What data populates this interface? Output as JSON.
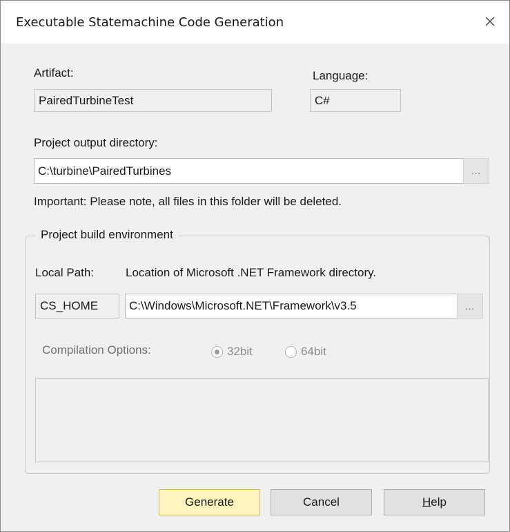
{
  "window": {
    "title": "Executable Statemachine Code Generation",
    "close_icon": "close-icon"
  },
  "artifact": {
    "label": "Artifact:",
    "value": "PairedTurbineTest"
  },
  "language": {
    "label": "Language:",
    "value": "C#"
  },
  "output": {
    "label": "Project output directory:",
    "value": "C:\\turbine\\PairedTurbines",
    "browse_label": "...",
    "note": "Important: Please note, all files in this folder will be deleted."
  },
  "build_env": {
    "group_label": "Project build environment",
    "local_path_label": "Local Path:",
    "local_path_desc": "Location of Microsoft .NET Framework directory.",
    "local_path_key": "CS_HOME",
    "local_path_value": "C:\\Windows\\Microsoft.NET\\Framework\\v3.5",
    "browse_label": "...",
    "compilation_label": "Compilation Options:",
    "option_32": "32bit",
    "option_64": "64bit",
    "selected_option": "32bit"
  },
  "buttons": {
    "generate": "Generate",
    "cancel": "Cancel",
    "help_first": "H",
    "help_rest": "elp"
  }
}
